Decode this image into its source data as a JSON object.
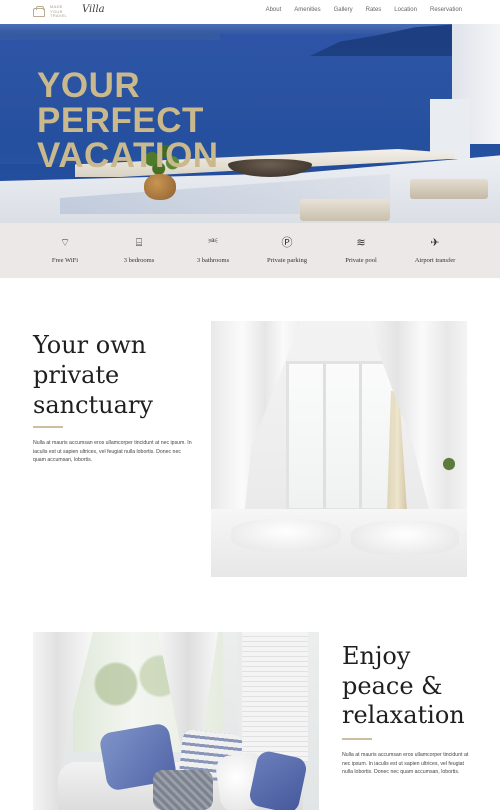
{
  "nav": {
    "logo_text": "Made your travel",
    "logo_script": "Villa",
    "items": [
      "About",
      "Amenities",
      "Gallery",
      "Rates",
      "Location",
      "Reservation"
    ]
  },
  "hero": {
    "title_lines": [
      "YOUR",
      "PERFECT",
      "VACATION"
    ]
  },
  "amenities": [
    {
      "label": "Free WiFi",
      "icon": "wifi-icon",
      "glyph": "⌔"
    },
    {
      "label": "3 bedrooms",
      "icon": "bed-icon",
      "glyph": "⌸"
    },
    {
      "label": "3 bathrooms",
      "icon": "bath-icon",
      "glyph": "⎃"
    },
    {
      "label": "Private parking",
      "icon": "parking-icon",
      "glyph": "Ⓟ"
    },
    {
      "label": "Private pool",
      "icon": "pool-icon",
      "glyph": "≋"
    },
    {
      "label": "Airport transfer",
      "icon": "airplane-icon",
      "glyph": "✈"
    }
  ],
  "section1": {
    "title_lines": [
      "Your own",
      "private",
      "sanctuary"
    ],
    "text": "Nulla at mauris accumsan eros ullamcorper tincidunt at nec ipsum. In iaculis est ut sapien ultrices, vel feugiat nulla lobortis. Donec nec quam accumsan, lobortis."
  },
  "section2": {
    "title_lines": [
      "Enjoy",
      "peace &",
      "relaxation"
    ],
    "text": "Nulla at mauris accumsan eros ullamcorper tincidunt at nec ipsum. In iaculis est ut sapien ultrices, vel feugiat nulla lobortis. Donec nec quam accumsan, lobortis."
  },
  "colors": {
    "accent_gold": "#c9b98d",
    "amenities_bg": "#ebe8e7",
    "rule_color": "#cbbf9f"
  }
}
